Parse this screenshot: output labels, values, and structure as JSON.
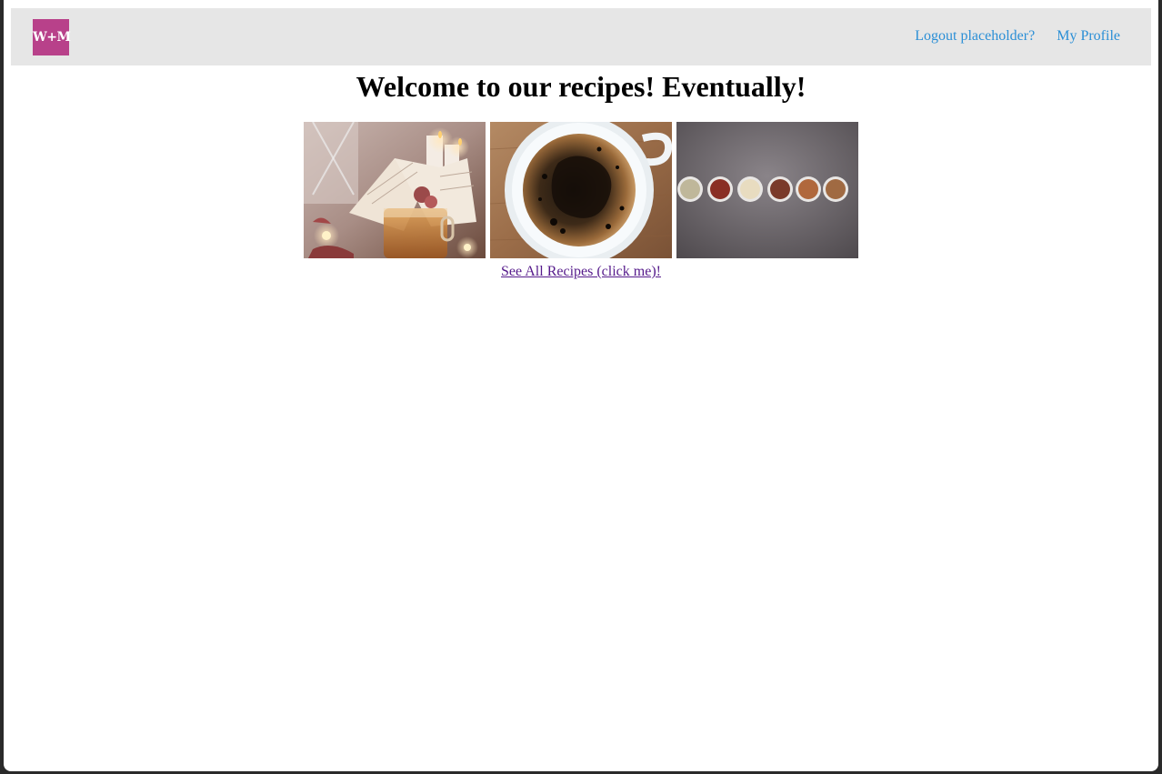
{
  "nav": {
    "logo_text": "W+M",
    "links": [
      {
        "label": "Logout placeholder?"
      },
      {
        "label": "My Profile"
      }
    ]
  },
  "main": {
    "title": "Welcome to our recipes! Eventually!",
    "images": [
      {
        "subject": "tea-candles-book"
      },
      {
        "subject": "coffee-cup"
      },
      {
        "subject": "nut-bowls"
      }
    ],
    "see_all_label": "See All Recipes (click me)!"
  },
  "colors": {
    "nav_background": "#e6e6e6",
    "logo_background": "#b8418a",
    "nav_link": "#2b8fd6",
    "visited_link": "#551a8b"
  }
}
